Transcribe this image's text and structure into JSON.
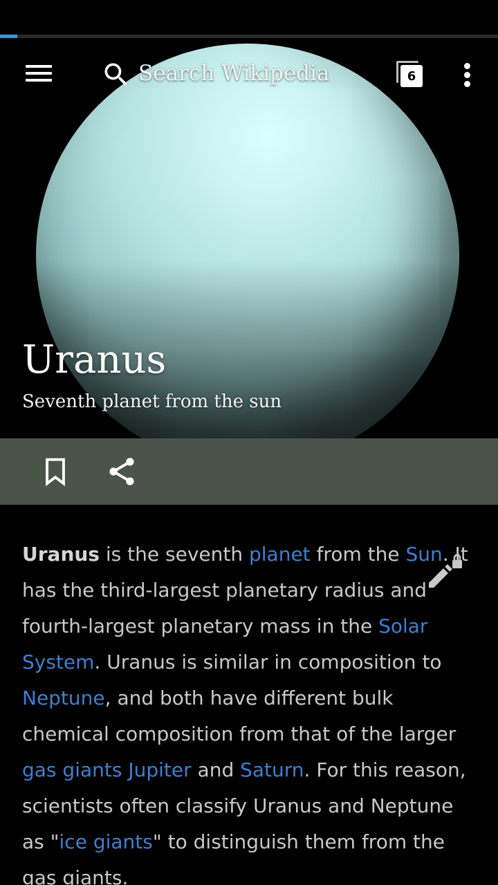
{
  "toolbar": {
    "search_placeholder": "Search Wikipedia",
    "tab_count": "6"
  },
  "progress": {
    "fraction": 0.035,
    "color": "#3a9ad9"
  },
  "article": {
    "title": "Uranus",
    "description": "Seventh planet from the sun",
    "paragraph": [
      {
        "text": "Uranus",
        "type": "bold"
      },
      {
        "text": " is the seventh ",
        "type": "text"
      },
      {
        "text": "planet",
        "type": "link"
      },
      {
        "text": " from the ",
        "type": "text"
      },
      {
        "text": "Sun",
        "type": "link"
      },
      {
        "text": ". It has the third-largest planetary radius and fourth-largest planetary mass in the ",
        "type": "text"
      },
      {
        "text": "Solar System",
        "type": "link"
      },
      {
        "text": ". Uranus is similar in composition to ",
        "type": "text"
      },
      {
        "text": "Neptune",
        "type": "link"
      },
      {
        "text": ", and both have different bulk chemical composition from that of the larger ",
        "type": "text"
      },
      {
        "text": "gas giants",
        "type": "link"
      },
      {
        "text": " ",
        "type": "text"
      },
      {
        "text": "Jupiter",
        "type": "link"
      },
      {
        "text": " and ",
        "type": "text"
      },
      {
        "text": "Saturn",
        "type": "link"
      },
      {
        "text": ". For this reason, scientists often classify Uranus and Neptune as \"",
        "type": "text"
      },
      {
        "text": "ice giants",
        "type": "link"
      },
      {
        "text": "\" to distinguish them from the gas giants.",
        "type": "text"
      }
    ]
  },
  "icons": {
    "menu": "hamburger-menu-icon",
    "search": "search-icon",
    "tabs": "tabs-icon",
    "more": "more-vert-icon",
    "bookmark": "bookmark-icon",
    "share": "share-icon",
    "edit": "edit-locked-icon"
  },
  "colors": {
    "background": "#000000",
    "action_bar": "#4b5449",
    "link": "#3f7fd1",
    "body_text": "#c9c9c9"
  }
}
